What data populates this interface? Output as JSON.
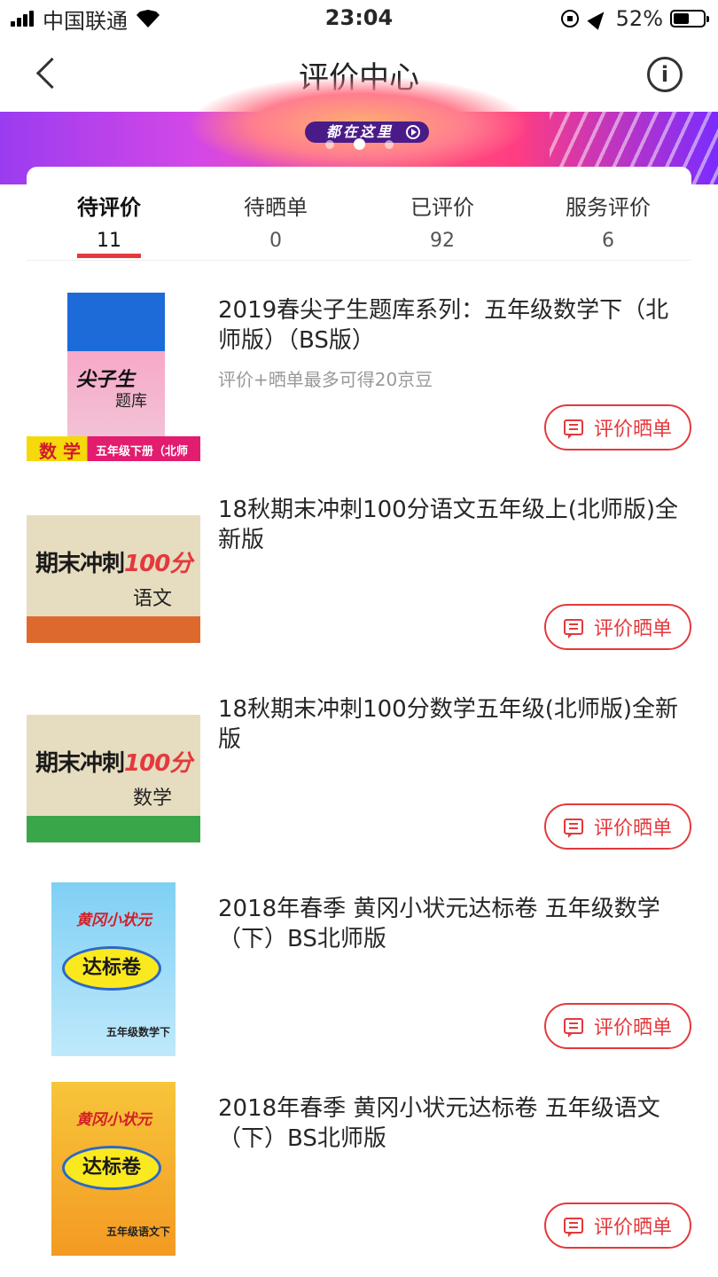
{
  "status": {
    "carrier": "中国联通",
    "time": "23:04",
    "battery": "52%",
    "battery_level": 0.52
  },
  "nav": {
    "title": "评价中心",
    "info_icon": "i"
  },
  "banner": {
    "text": "都在这里"
  },
  "tabs": [
    {
      "label": "待评价",
      "count": "11"
    },
    {
      "label": "待晒单",
      "count": "0"
    },
    {
      "label": "已评价",
      "count": "92"
    },
    {
      "label": "服务评价",
      "count": "6"
    }
  ],
  "items": [
    {
      "title": "2019春尖子生题库系列：五年级数学下（北师版）（BS版）",
      "subtitle": "评价+晒单最多可得20京豆",
      "button": "评价晒单",
      "cover": {
        "line1": "尖子生",
        "line2": "题库",
        "band_left": "数 学",
        "band_right": "五年级下册（北师版）"
      }
    },
    {
      "title": "18秋期末冲刺100分语文五年级上(北师版)全新版",
      "subtitle": "",
      "button": "评价晒单",
      "cover": {
        "big": "期末冲刺",
        "num": "100分",
        "sub": "语文"
      }
    },
    {
      "title": "18秋期末冲刺100分数学五年级(北师版)全新版",
      "subtitle": "",
      "button": "评价晒单",
      "cover": {
        "big": "期末冲刺",
        "num": "100分",
        "sub": "数学"
      }
    },
    {
      "title": "2018年春季 黄冈小状元达标卷 五年级数学（下）BS北师版",
      "subtitle": "",
      "button": "评价晒单",
      "cover": {
        "top": "黄冈小状元",
        "oval": "达标卷",
        "bottom": "五年级数学下"
      }
    },
    {
      "title": "2018年春季 黄冈小状元达标卷 五年级语文（下）BS北师版",
      "subtitle": "",
      "button": "评价晒单",
      "cover": {
        "top": "黄冈小状元",
        "oval": "达标卷",
        "bottom": "五年级语文下"
      }
    }
  ]
}
